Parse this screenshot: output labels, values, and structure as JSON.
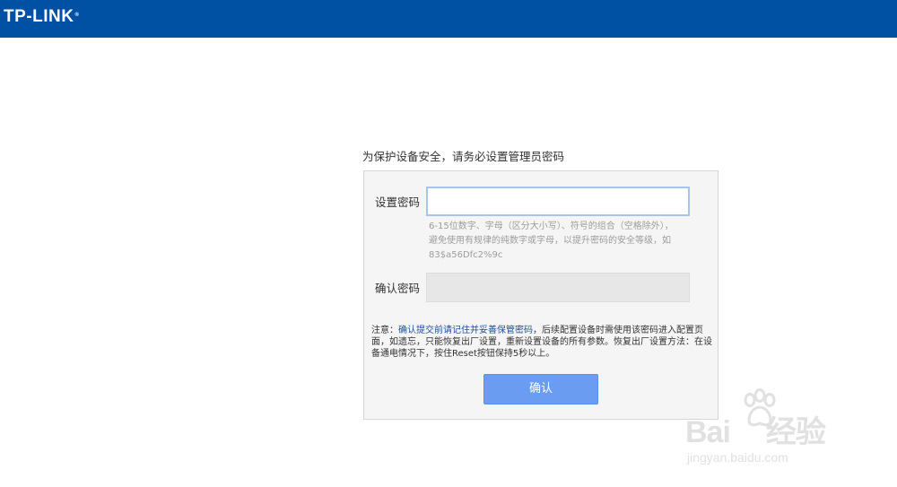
{
  "header": {
    "logo": "TP-LINK",
    "logo_mark": "®",
    "brand_color": "#0051a4"
  },
  "intro": "为保护设备安全，请务必设置管理员密码",
  "form": {
    "password_label": "设置密码",
    "password_value": "",
    "hint_lines": [
      "6-15位数字、字母（区分大小写）、符号的组合（空格除外），",
      "避免使用有规律的纯数字或字母，以提升密码的安全等级，如",
      "83$a56Dfc2%9c"
    ],
    "confirm_label": "确认密码",
    "confirm_value": ""
  },
  "note": {
    "prefix": "注意：",
    "highlight": "确认提交前请记住并妥善保管密码",
    "rest": "，后续配置设备时需使用该密码进入配置页面，如遗忘，只能恢复出厂设置，重新设置设备的所有参数。恢复出厂设置方法：在设备通电情况下，按住Reset按钮保持5秒以上。"
  },
  "submit_label": "确认",
  "watermark": {
    "main": "Bai",
    "main2": "经验",
    "sub": "jingyan.baidu.com",
    "icon": "paw-icon"
  }
}
